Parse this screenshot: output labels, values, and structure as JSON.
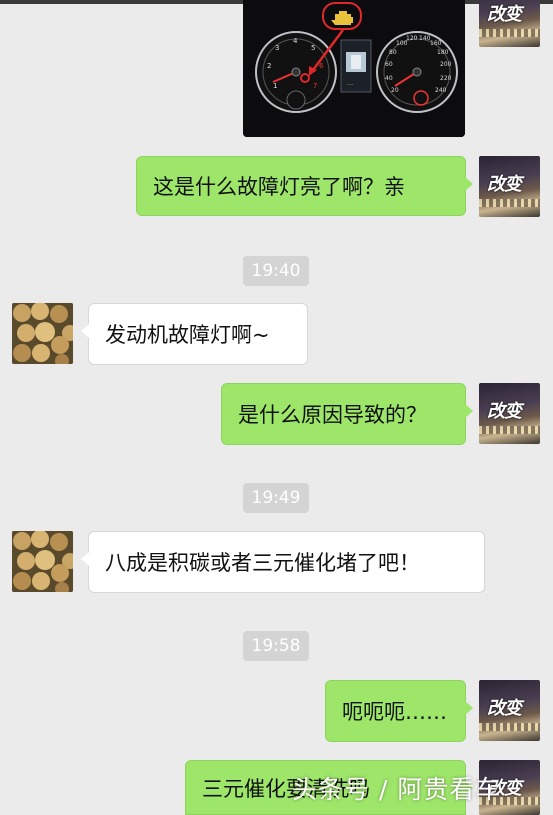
{
  "messages": [
    {
      "side": "right",
      "type": "image",
      "alt": "dashboard-photo"
    },
    {
      "side": "right",
      "type": "text",
      "text": "这是什么故障灯亮了啊？亲"
    },
    {
      "type": "time",
      "text": "19:40"
    },
    {
      "side": "left",
      "type": "text",
      "text": "发动机故障灯啊~"
    },
    {
      "side": "right",
      "type": "text",
      "text": "是什么原因导致的？"
    },
    {
      "type": "time",
      "text": "19:49"
    },
    {
      "side": "left",
      "type": "text",
      "text": "八成是积碳或者三元催化堵了吧！"
    },
    {
      "type": "time",
      "text": "19:58"
    },
    {
      "side": "right",
      "type": "text",
      "text": "呃呃呃……"
    },
    {
      "side": "right",
      "type": "text",
      "text": "三元催化要清洗吗"
    }
  ],
  "avatars": {
    "right": {
      "badge": "改变"
    },
    "left": {
      "icon": "beans-photo"
    }
  },
  "colors": {
    "background": "#ebebeb",
    "sent_bubble": "#9ee66a",
    "received_bubble": "#ffffff",
    "timestamp_bg": "#d4d4d4",
    "warning_light": "#e8c23a",
    "warning_arrow": "#e0282a"
  },
  "dashboard": {
    "left_gauge_ticks": [
      "1",
      "2",
      "3",
      "4",
      "5",
      "6",
      "7"
    ],
    "right_gauge_ticks": [
      "20",
      "40",
      "60",
      "80",
      "100",
      "120",
      "140",
      "160",
      "180",
      "200",
      "220",
      "240"
    ]
  },
  "watermark": "头条号 / 阿贵看车"
}
